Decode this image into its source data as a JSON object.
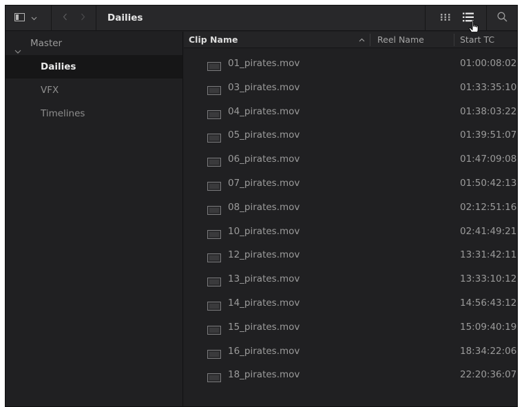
{
  "toolbar": {
    "panel_toggle_icon": "sidebar-panel-icon",
    "panel_dropdown_icon": "chevron-down-icon",
    "back_icon": "chevron-left-icon",
    "forward_icon": "chevron-right-icon",
    "bin_title": "Dailies",
    "thumbnail_view_icon": "grid-dots-icon",
    "list_view_icon": "list-view-icon",
    "search_icon": "search-icon"
  },
  "sidebar": {
    "root_label": "Master",
    "items": [
      {
        "label": "Dailies",
        "selected": true
      },
      {
        "label": "VFX",
        "selected": false
      },
      {
        "label": "Timelines",
        "selected": false
      }
    ]
  },
  "list": {
    "columns": {
      "clip_name": "Clip Name",
      "reel_name": "Reel Name",
      "start_tc": "Start TC"
    },
    "sort": {
      "column": "clip_name",
      "direction": "ascending"
    },
    "rows": [
      {
        "name": "01_pirates.mov",
        "start_tc": "01:00:08:02"
      },
      {
        "name": "03_pirates.mov",
        "start_tc": "01:33:35:10"
      },
      {
        "name": "04_pirates.mov",
        "start_tc": "01:38:03:22"
      },
      {
        "name": "05_pirates.mov",
        "start_tc": "01:39:51:07"
      },
      {
        "name": "06_pirates.mov",
        "start_tc": "01:47:09:08"
      },
      {
        "name": "07_pirates.mov",
        "start_tc": "01:50:42:13"
      },
      {
        "name": "08_pirates.mov",
        "start_tc": "02:12:51:16"
      },
      {
        "name": "10_pirates.mov",
        "start_tc": "02:41:49:21"
      },
      {
        "name": "12_pirates.mov",
        "start_tc": "13:31:42:11"
      },
      {
        "name": "13_pirates.mov",
        "start_tc": "13:33:10:12"
      },
      {
        "name": "14_pirates.mov",
        "start_tc": "14:56:43:12"
      },
      {
        "name": "15_pirates.mov",
        "start_tc": "15:09:40:19"
      },
      {
        "name": "16_pirates.mov",
        "start_tc": "18:34:22:06"
      },
      {
        "name": "18_pirates.mov",
        "start_tc": "22:20:36:07"
      }
    ]
  }
}
